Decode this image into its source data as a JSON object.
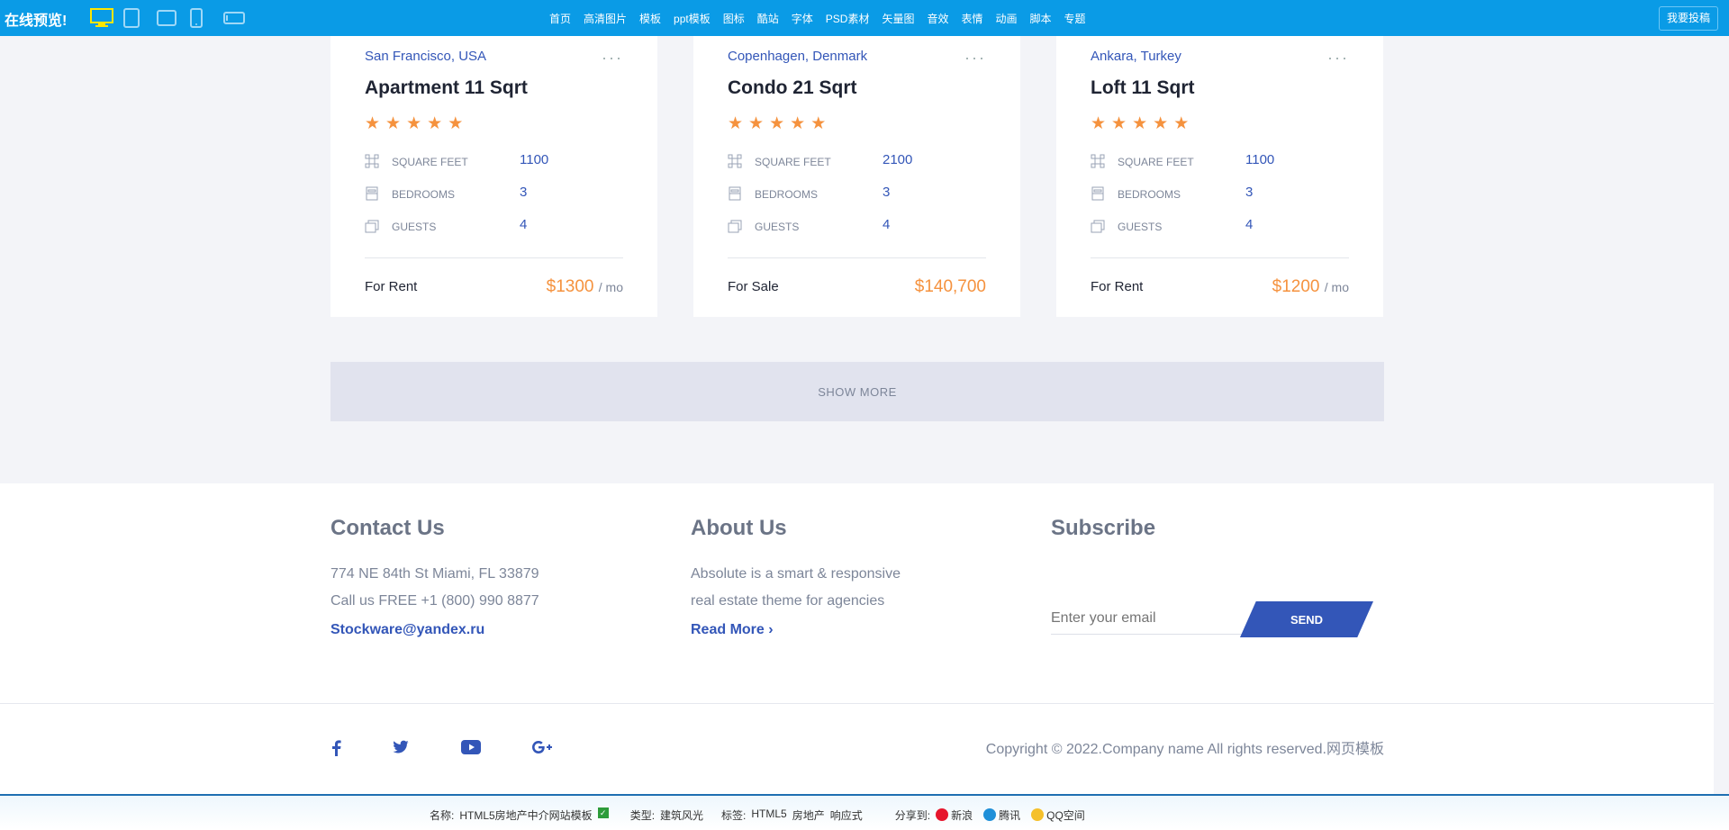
{
  "topbar": {
    "brand": "在线预览!",
    "nav": [
      "首页",
      "高清图片",
      "模板",
      "ppt模板",
      "图标",
      "酷站",
      "字体",
      "PSD素材",
      "矢量图",
      "音效",
      "表情",
      "动画",
      "脚本",
      "专题"
    ],
    "submit_label": "我要投稿"
  },
  "cards": [
    {
      "location": "San Francisco, USA",
      "title": "Apartment 11 Sqrt",
      "rating": 5,
      "features": [
        {
          "label": "SQUARE FEET",
          "value": "1100"
        },
        {
          "label": "BEDROOMS",
          "value": "3"
        },
        {
          "label": "GUESTS",
          "value": "4"
        }
      ],
      "status": "For Rent",
      "price": "$1300",
      "per": "/ mo"
    },
    {
      "location": "Copenhagen, Denmark",
      "title": "Condo 21 Sqrt",
      "rating": 5,
      "features": [
        {
          "label": "SQUARE FEET",
          "value": "2100"
        },
        {
          "label": "BEDROOMS",
          "value": "3"
        },
        {
          "label": "GUESTS",
          "value": "4"
        }
      ],
      "status": "For Sale",
      "price": "$140,700",
      "per": ""
    },
    {
      "location": "Ankara, Turkey",
      "title": "Loft 11 Sqrt",
      "rating": 5,
      "features": [
        {
          "label": "SQUARE FEET",
          "value": "1100"
        },
        {
          "label": "BEDROOMS",
          "value": "3"
        },
        {
          "label": "GUESTS",
          "value": "4"
        }
      ],
      "status": "For Rent",
      "price": "$1200",
      "per": "/ mo"
    }
  ],
  "show_more_label": "SHOW MORE",
  "footer": {
    "contact": {
      "heading": "Contact Us",
      "address": "774 NE 84th St Miami, FL 33879",
      "phone": "Call us FREE +1 (800) 990 8877",
      "email": "Stockware@yandex.ru"
    },
    "about": {
      "heading": "About Us",
      "line1": "Absolute is a smart & responsive",
      "line2": "real estate theme for agencies",
      "link": "Read More ›"
    },
    "subscribe": {
      "heading": "Subscribe",
      "placeholder": "Enter your email",
      "button": "SEND"
    },
    "copyright": "Copyright © 2022.Company name All rights reserved.网页模板"
  },
  "infobar": {
    "name_label": "名称:",
    "name_value": "HTML5房地产中介网站模板",
    "type_label": "类型:",
    "type_value": "建筑风光",
    "tags_label": "标签:",
    "tags": [
      "HTML5",
      "房地产",
      "响应式"
    ],
    "share_label": "分享到:",
    "share": [
      "新浪",
      "腾讯",
      "QQ空间"
    ]
  },
  "colors": {
    "topbar": "#0a9be6",
    "accent": "#3356b8",
    "price": "#f5923e",
    "device_active": "#ffe600"
  }
}
